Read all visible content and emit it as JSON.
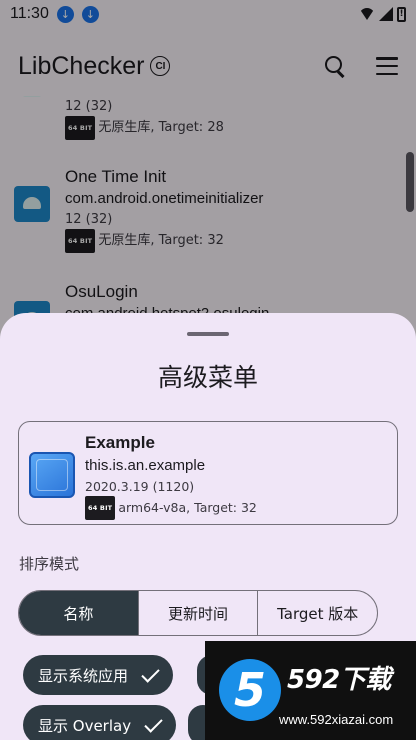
{
  "status_bar": {
    "time": "11:30"
  },
  "app_bar": {
    "title": "LibChecker",
    "badge": "CI"
  },
  "app_list": [
    {
      "name": "",
      "package": "",
      "version": "12 (32)",
      "bit": "64 BIT",
      "meta": "无原生库, Target: 28"
    },
    {
      "name": "One Time Init",
      "package": "com.android.onetimeinitializer",
      "version": "12 (32)",
      "bit": "64 BIT",
      "meta": "无原生库, Target: 32"
    },
    {
      "name": "OsuLogin",
      "package": "com.android.hotspot2.osulogin",
      "version": "",
      "bit": "",
      "meta": ""
    }
  ],
  "sheet": {
    "title": "高级菜单",
    "example": {
      "name": "Example",
      "package": "this.is.an.example",
      "version": "2020.3.19 (1120)",
      "bit": "64 BIT",
      "meta": "arm64-v8a, Target: 32"
    },
    "sort_label": "排序模式",
    "sort_options": [
      "名称",
      "更新时间",
      "Target 版本"
    ],
    "sort_selected": "名称",
    "chips": [
      {
        "label": "显示系统应用",
        "checked": true
      },
      {
        "label": "显示 Overlay",
        "checked": true
      }
    ]
  },
  "watermark": {
    "logo": "5",
    "text": "592下载",
    "url": "www.592xiazai.com"
  },
  "colors": {
    "accent": "#2e3a42",
    "sheet_bg": "#f0e6f7",
    "app_icon": "#1e88c8"
  }
}
